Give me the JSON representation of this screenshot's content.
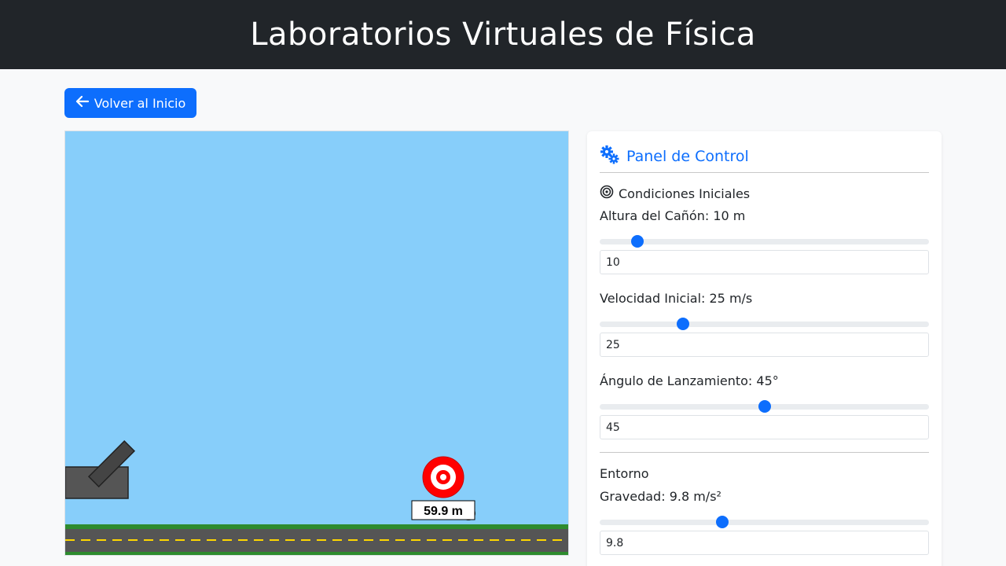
{
  "header": {
    "title": "Laboratorios Virtuales de Física"
  },
  "nav": {
    "back_label": "Volver al Inicio",
    "back_icon": "arrow-left-icon"
  },
  "simulation": {
    "target_distance_label": "59.9 m",
    "sky_color": "#87cefa",
    "grass_color": "#2e8b2e",
    "road_color": "#555555",
    "lane_color": "#ffd700",
    "target_color": "#ff0000"
  },
  "panel": {
    "title": "Panel de Control",
    "icon": "gears-icon",
    "initial_conditions": {
      "title": "Condiciones Iniciales",
      "icon": "bullseye-icon",
      "height": {
        "label": "Altura del Cañón: 10 m",
        "value": "10",
        "fraction": 0.115
      },
      "velocity": {
        "label": "Velocidad Inicial: 25 m/s",
        "value": "25",
        "fraction": 0.253
      },
      "angle": {
        "label": "Ángulo de Lanzamiento: 45°",
        "value": "45",
        "fraction": 0.5
      }
    },
    "environment": {
      "title": "Entorno",
      "gravity": {
        "label": "Gravedad: 9.8 m/s²",
        "value": "9.8",
        "fraction": 0.372
      }
    }
  },
  "colors": {
    "accent": "#0d6efd",
    "topbar": "#212529"
  }
}
